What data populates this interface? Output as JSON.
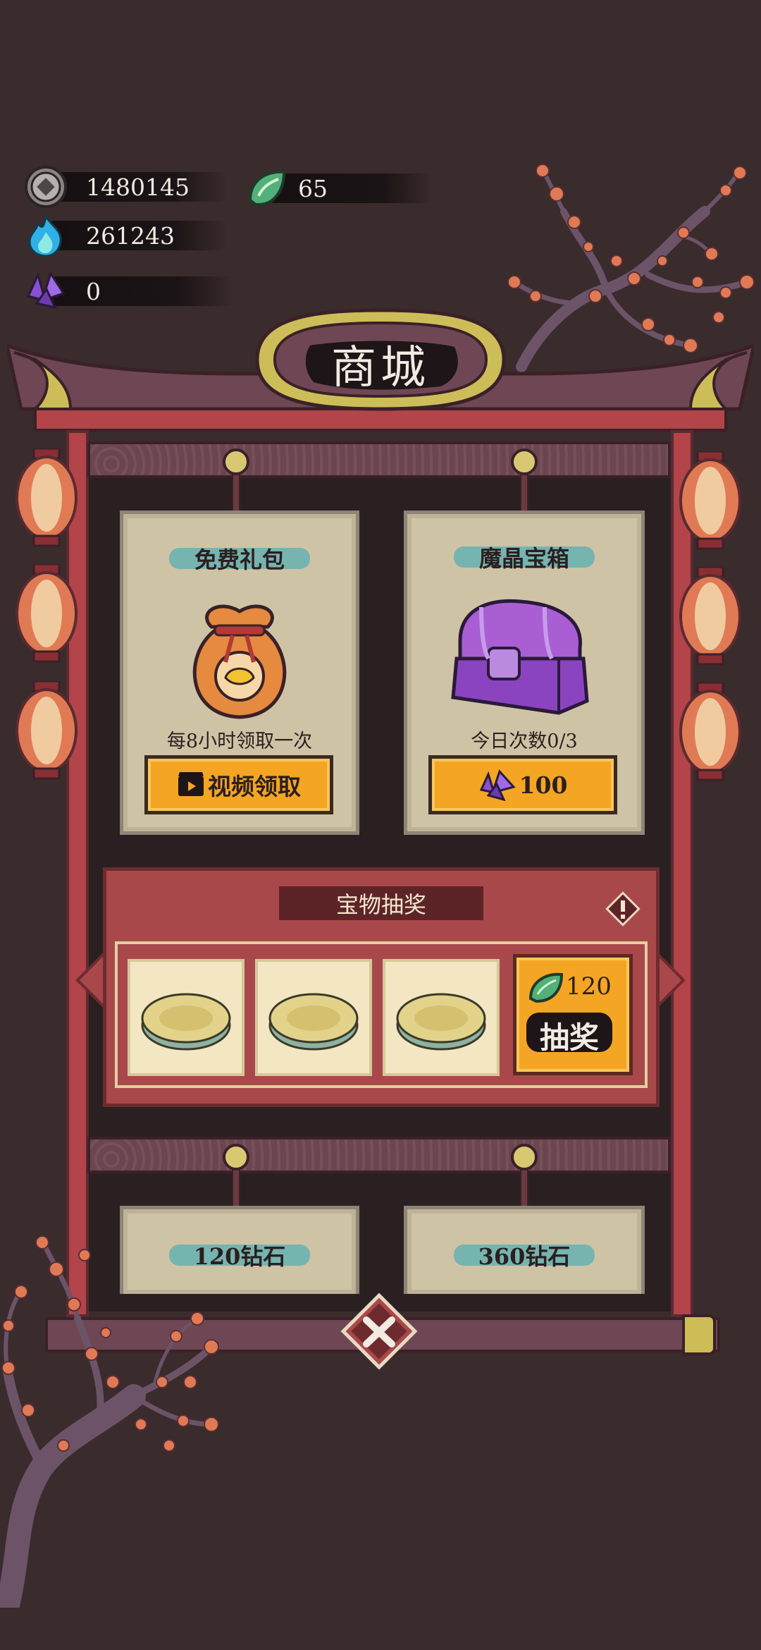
{
  "currencies": {
    "coins": "1480145",
    "leaf": "65",
    "fire": "261243",
    "crystal": "0"
  },
  "shop_title": "商城",
  "free_gift": {
    "title": "免费礼包",
    "caption": "每8小时领取一次",
    "button_label": "视频领取"
  },
  "crystal_chest": {
    "title": "魔晶宝箱",
    "caption": "今日次数0/3",
    "price": "100"
  },
  "lottery": {
    "title": "宝物抽奖",
    "cost": "120",
    "draw_label": "抽奖"
  },
  "diamond_packs": [
    {
      "label": "120钻石"
    },
    {
      "label": "360钻石"
    }
  ],
  "colors": {
    "background": "#3a2b2c",
    "frame_red": "#b2444a",
    "card_bg": "#cfc3a6",
    "button_orange": "#f4a524",
    "title_teal": "#66b2b1"
  },
  "icons": [
    "coin-icon",
    "leaf-icon",
    "fire-icon",
    "crystal-icon",
    "video-icon",
    "info-icon",
    "close-icon"
  ]
}
